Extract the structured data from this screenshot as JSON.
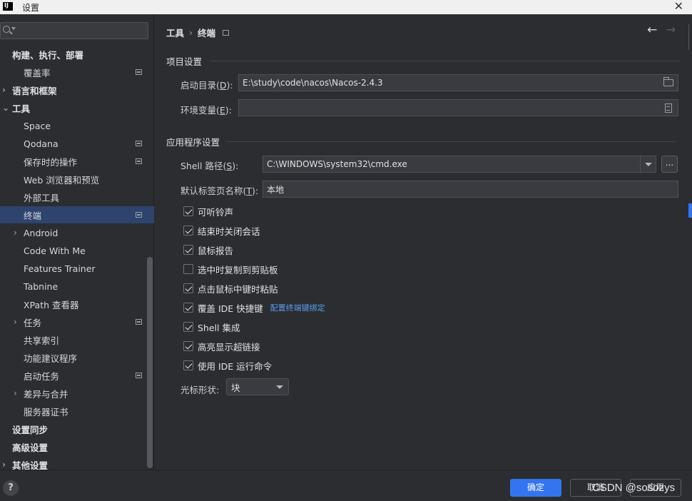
{
  "window": {
    "title": "设置",
    "logo": "IJ"
  },
  "search": {
    "placeholder": ""
  },
  "sidebar": {
    "items": [
      {
        "label": "构建、执行、部署",
        "bold": true,
        "arrow": "",
        "page": false
      },
      {
        "label": "覆盖率",
        "bold": false,
        "arrow": "",
        "page": true
      },
      {
        "label": "语言和框架",
        "bold": true,
        "arrow": "›",
        "page": false
      },
      {
        "label": "工具",
        "bold": true,
        "arrow": "⌄",
        "page": false
      },
      {
        "label": "Space",
        "bold": false,
        "arrow": "",
        "page": false
      },
      {
        "label": "Qodana",
        "bold": false,
        "arrow": "",
        "page": true
      },
      {
        "label": "保存时的操作",
        "bold": false,
        "arrow": "",
        "page": true
      },
      {
        "label": "Web 浏览器和预览",
        "bold": false,
        "arrow": "",
        "page": false
      },
      {
        "label": "外部工具",
        "bold": false,
        "arrow": "",
        "page": false
      },
      {
        "label": "终端",
        "bold": false,
        "arrow": "",
        "page": true,
        "selected": true
      },
      {
        "label": "Android",
        "bold": false,
        "arrow": "›",
        "page": false
      },
      {
        "label": "Code With Me",
        "bold": false,
        "arrow": "",
        "page": false
      },
      {
        "label": "Features Trainer",
        "bold": false,
        "arrow": "",
        "page": false
      },
      {
        "label": "Tabnine",
        "bold": false,
        "arrow": "",
        "page": false
      },
      {
        "label": "XPath 查看器",
        "bold": false,
        "arrow": "",
        "page": false
      },
      {
        "label": "任务",
        "bold": false,
        "arrow": "›",
        "page": true
      },
      {
        "label": "共享索引",
        "bold": false,
        "arrow": "",
        "page": false
      },
      {
        "label": "功能建议程序",
        "bold": false,
        "arrow": "",
        "page": false
      },
      {
        "label": "启动任务",
        "bold": false,
        "arrow": "",
        "page": true
      },
      {
        "label": "差异与合并",
        "bold": false,
        "arrow": "›",
        "page": false
      },
      {
        "label": "服务器证书",
        "bold": false,
        "arrow": "",
        "page": false
      },
      {
        "label": "设置同步",
        "bold": true,
        "arrow": "",
        "page": false
      },
      {
        "label": "高级设置",
        "bold": true,
        "arrow": "",
        "page": false
      },
      {
        "label": "其他设置",
        "bold": true,
        "arrow": "›",
        "page": false
      }
    ]
  },
  "breadcrumb": {
    "parent": "工具",
    "separator": "›",
    "current": "终端"
  },
  "project_settings": {
    "header": "项目设置",
    "start_dir_label": "启动目录(",
    "start_dir_mnemonic": "D",
    "start_dir_label_end": "):",
    "start_dir_value": "E:\\study\\code\\nacos\\Nacos-2.4.3",
    "env_label": "环境变量(",
    "env_mnemonic": "E",
    "env_label_end": "):",
    "env_value": ""
  },
  "app_settings": {
    "header": "应用程序设置",
    "shell_label": "Shell 路径(",
    "shell_mnemonic": "S",
    "shell_label_end": "):",
    "shell_value": "C:\\WINDOWS\\system32\\cmd.exe",
    "browse_label": "...",
    "tab_name_label": "默认标签页名称(",
    "tab_name_mnemonic": "T",
    "tab_name_label_end": "):",
    "tab_name_value": "本地",
    "checkboxes": [
      {
        "label": "可听铃声",
        "checked": true
      },
      {
        "label": "结束时关闭会话",
        "checked": true
      },
      {
        "label": "鼠标报告",
        "checked": true
      },
      {
        "label": "选中时复制到剪贴板",
        "checked": false
      },
      {
        "label": "点击鼠标中键时粘贴",
        "checked": true
      },
      {
        "label": "覆盖 IDE 快捷键",
        "checked": true,
        "link": "配置终端键绑定"
      },
      {
        "label": "Shell 集成",
        "checked": true
      },
      {
        "label": "高亮显示超链接",
        "checked": true
      },
      {
        "label": "使用 IDE 运行命令",
        "checked": true
      }
    ],
    "cursor_shape_label": "光标形状:",
    "cursor_shape_value": "块"
  },
  "footer": {
    "help": "?",
    "ok": "确定",
    "cancel": "取消",
    "apply": "应用",
    "watermark": "CSDN @sosozys"
  },
  "colors": {
    "accent": "#3574f0",
    "selection": "#2e436e",
    "background": "#2b2d30"
  }
}
